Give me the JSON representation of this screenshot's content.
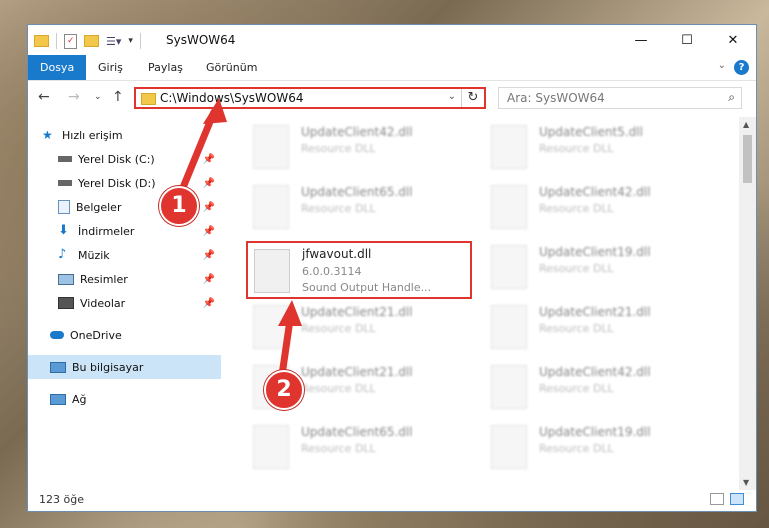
{
  "window": {
    "title": "SysWOW64",
    "controls": {
      "minimize": "—",
      "maximize": "☐",
      "close": "✕"
    }
  },
  "ribbon": {
    "tabs": [
      {
        "label": "Dosya",
        "active": true
      },
      {
        "label": "Giriş"
      },
      {
        "label": "Paylaş"
      },
      {
        "label": "Görünüm"
      }
    ],
    "help": "?"
  },
  "address": {
    "path": "C:\\Windows\\SysWOW64"
  },
  "search": {
    "placeholder": "Ara: SysWOW64"
  },
  "sidebar": {
    "items": [
      {
        "label": "Hızlı erişim",
        "icon": "star-icon",
        "pinned": false
      },
      {
        "label": "Yerel Disk (C:)",
        "icon": "drive-icon",
        "pinned": true
      },
      {
        "label": "Yerel Disk (D:)",
        "icon": "drive-icon",
        "pinned": true
      },
      {
        "label": "Belgeler",
        "icon": "documents-icon",
        "pinned": true
      },
      {
        "label": "İndirmeler",
        "icon": "download-icon",
        "pinned": true
      },
      {
        "label": "Müzik",
        "icon": "music-icon",
        "pinned": true
      },
      {
        "label": "Resimler",
        "icon": "pictures-icon",
        "pinned": true
      },
      {
        "label": "Videolar",
        "icon": "video-icon",
        "pinned": true
      },
      {
        "label": "OneDrive",
        "icon": "cloud-icon",
        "pinned": false
      },
      {
        "label": "Bu bilgisayar",
        "icon": "computer-icon",
        "pinned": false,
        "selected": true
      },
      {
        "label": "Ağ",
        "icon": "network-icon",
        "pinned": false
      }
    ]
  },
  "files": [
    {
      "name": "UpdateClient42.dll",
      "desc": "Resource DLL"
    },
    {
      "name": "UpdateClient5.dll",
      "desc": "Resource DLL"
    },
    {
      "name": "UpdateClient65.dll",
      "desc": "Resource DLL"
    },
    {
      "name": "UpdateClient42.dll",
      "desc": "Resource DLL"
    },
    {
      "name": "jfwavout.dll",
      "desc": "6.0.0.3114",
      "sub": "Sound Output Handle..."
    },
    {
      "name": "UpdateClient19.dll",
      "desc": "Resource DLL"
    },
    {
      "name": "UpdateClient21.dll",
      "desc": "Resource DLL"
    },
    {
      "name": "UpdateClient21.dll",
      "desc": "Resource DLL"
    },
    {
      "name": "UpdateClient21.dll",
      "desc": "Resource DLL"
    },
    {
      "name": "UpdateClient42.dll",
      "desc": "Resource DLL"
    },
    {
      "name": "UpdateClient65.dll",
      "desc": "Resource DLL"
    },
    {
      "name": "UpdateClient19.dll",
      "desc": "Resource DLL"
    }
  ],
  "status": {
    "count": "123 öğe"
  },
  "callouts": {
    "one": "1",
    "two": "2"
  },
  "colors": {
    "accent": "#1979ca",
    "highlight": "#e0342f",
    "selected": "#cce4f7"
  }
}
